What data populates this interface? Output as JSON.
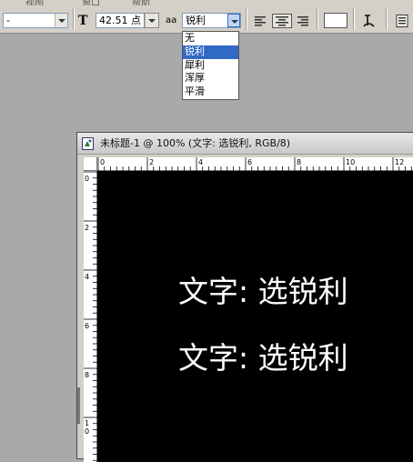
{
  "menubar": {
    "items": [
      "视图",
      "窗口",
      "帮助"
    ]
  },
  "options_bar": {
    "style_value": "-",
    "font_size": "42.51 点",
    "antialias_value": "锐利",
    "antialias_label": "aa",
    "font_size_label": "T"
  },
  "antialias_dropdown": {
    "options": [
      "无",
      "锐利",
      "犀利",
      "浑厚",
      "平滑"
    ],
    "selected": "锐利"
  },
  "document": {
    "title": "未标题-1 @ 100% (文字: 选锐利, RGB/8)",
    "hruler_labels": [
      "0",
      "2",
      "4",
      "6",
      "8",
      "10",
      "12"
    ],
    "vruler_labels": [
      "0",
      "2",
      "4",
      "6",
      "8",
      "1\n0"
    ],
    "canvas_lines": [
      "文字: 选锐利",
      "文字: 选锐利"
    ],
    "canvas_color": "#000000",
    "text_color": "#ffffff"
  },
  "colors": {
    "selection": "#316ac5",
    "chrome": "#d4d0c8",
    "workspace": "#a9a9a9"
  }
}
